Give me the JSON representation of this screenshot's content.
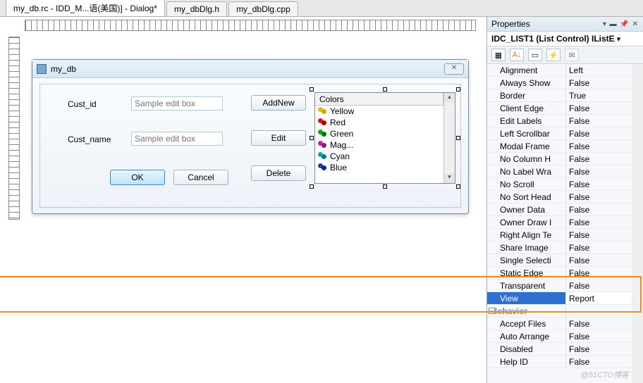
{
  "tabs": {
    "t0": "my_db.rc - IDD_M...语(美国)] - Dialog*",
    "t1": "my_dbDlg.h",
    "t2": "my_dbDlg.cpp"
  },
  "dialog": {
    "title": "my_db",
    "labels": {
      "cust_id": "Cust_id",
      "cust_name": "Cust_name"
    },
    "placeholders": {
      "edit": "Sample edit box"
    },
    "buttons": {
      "addnew": "AddNew",
      "edit": "Edit",
      "delete": "Delete",
      "ok": "OK",
      "cancel": "Cancel"
    },
    "list": {
      "header": "Colors",
      "items": [
        "Yellow",
        "Red",
        "Green",
        "Mag...",
        "Cyan",
        "Blue"
      ]
    }
  },
  "properties": {
    "title": "Properties",
    "selection": "IDC_LIST1 (List Control) IListE",
    "rows": [
      {
        "name": "Alignment",
        "val": "Left"
      },
      {
        "name": "Always Show",
        "val": "False"
      },
      {
        "name": "Border",
        "val": "True"
      },
      {
        "name": "Client Edge",
        "val": "False"
      },
      {
        "name": "Edit Labels",
        "val": "False"
      },
      {
        "name": "Left Scrollbar",
        "val": "False"
      },
      {
        "name": "Modal Frame",
        "val": "False"
      },
      {
        "name": "No Column H",
        "val": "False"
      },
      {
        "name": "No Label Wra",
        "val": "False"
      },
      {
        "name": "No Scroll",
        "val": "False"
      },
      {
        "name": "No Sort Head",
        "val": "False"
      },
      {
        "name": "Owner Data",
        "val": "False"
      },
      {
        "name": "Owner Draw I",
        "val": "False"
      },
      {
        "name": "Right Align Te",
        "val": "False"
      },
      {
        "name": "Share Image",
        "val": "False"
      },
      {
        "name": "Single Selecti",
        "val": "False"
      },
      {
        "name": "Static Edge",
        "val": "False"
      },
      {
        "name": "Transparent",
        "val": "False"
      },
      {
        "name": "View",
        "val": "Report"
      }
    ],
    "category": "Behavior",
    "rows2": [
      {
        "name": "Accept Files",
        "val": "False"
      },
      {
        "name": "Auto Arrange",
        "val": "False"
      },
      {
        "name": "Disabled",
        "val": "False"
      },
      {
        "name": "Help ID",
        "val": "False"
      }
    ]
  },
  "watermark": "@51CTO博客"
}
